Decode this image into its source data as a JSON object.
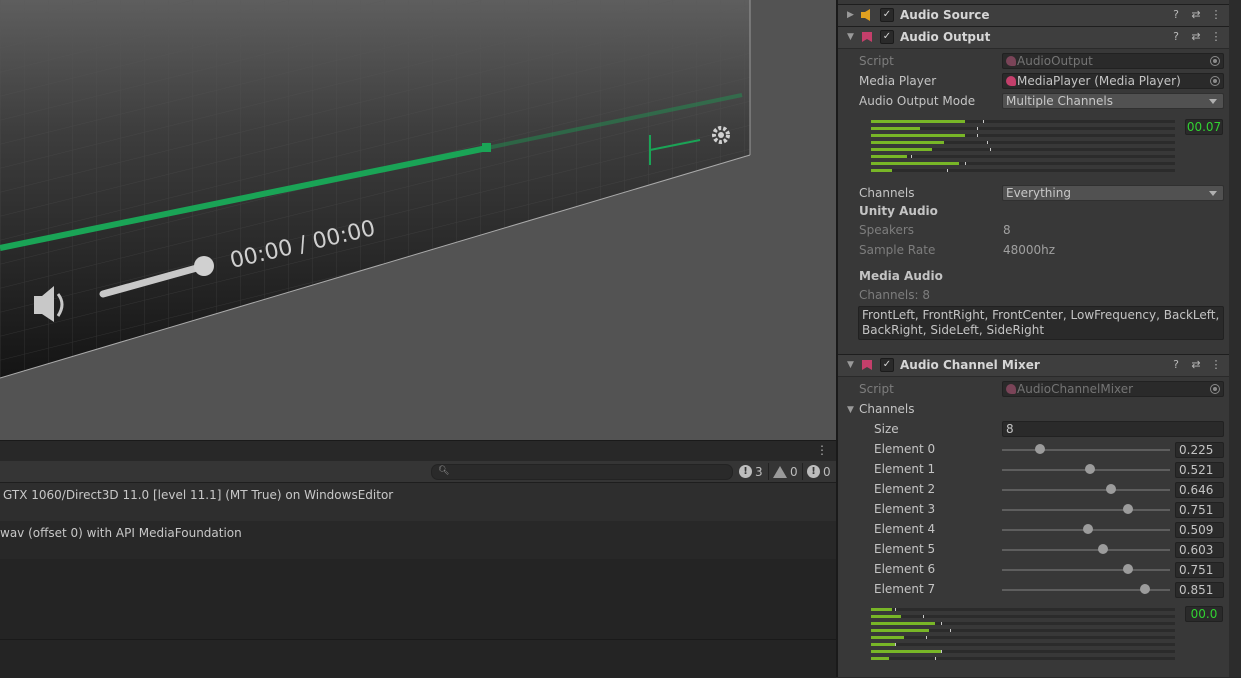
{
  "scene": {
    "time_display": "00:00 / 00:00",
    "accent_color": "#1aa456"
  },
  "console": {
    "counts": {
      "errors": "3",
      "warnings": "0",
      "infos": "0"
    },
    "search_placeholder": "",
    "logs": [
      "GTX 1060/Direct3D 11.0 [level 11.1] (MT True) on WindowsEditor",
      "wav (offset 0) with API MediaFoundation"
    ]
  },
  "inspector": {
    "audio_source": {
      "title": "Audio Source",
      "enabled": true
    },
    "audio_output": {
      "title": "Audio Output",
      "script_label": "Script",
      "script_value": "AudioOutput",
      "media_player_label": "Media Player",
      "media_player_value": "MediaPlayer (Media Player)",
      "output_mode_label": "Audio Output Mode",
      "output_mode_value": "Multiple Channels",
      "meter_value": "00.07",
      "meter_levels": [
        0.31,
        0.16,
        0.31,
        0.24,
        0.2,
        0.12,
        0.29,
        0.07
      ],
      "meter_peaks": [
        0.37,
        0.35,
        0.35,
        0.38,
        0.39,
        0.13,
        0.31,
        0.25
      ],
      "channels_label": "Channels",
      "channels_value": "Everything",
      "unity_audio_header": "Unity Audio",
      "speakers_label": "Speakers",
      "speakers_value": "8",
      "sample_rate_label": "Sample Rate",
      "sample_rate_value": "48000hz",
      "media_audio_header": "Media Audio",
      "media_channels_text": "Channels: 8",
      "channel_layout_text": "FrontLeft, FrontRight, FrontCenter, LowFrequency, BackLeft, BackRight, SideLeft, SideRight"
    },
    "audio_channel_mixer": {
      "title": "Audio Channel Mixer",
      "script_label": "Script",
      "script_value": "AudioChannelMixer",
      "channels_label": "Channels",
      "size_label": "Size",
      "size_value": "8",
      "elements": [
        {
          "label": "Element 0",
          "value": "0.225",
          "level": 0.225
        },
        {
          "label": "Element 1",
          "value": "0.521",
          "level": 0.521
        },
        {
          "label": "Element 2",
          "value": "0.646",
          "level": 0.646
        },
        {
          "label": "Element 3",
          "value": "0.751",
          "level": 0.751
        },
        {
          "label": "Element 4",
          "value": "0.509",
          "level": 0.509
        },
        {
          "label": "Element 5",
          "value": "0.603",
          "level": 0.603
        },
        {
          "label": "Element 6",
          "value": "0.751",
          "level": 0.751
        },
        {
          "label": "Element 7",
          "value": "0.851",
          "level": 0.851
        }
      ],
      "meter_value": "00.0",
      "meter_levels": [
        0.07,
        0.1,
        0.21,
        0.19,
        0.11,
        0.08,
        0.23,
        0.06
      ],
      "meter_peaks": [
        0.08,
        0.17,
        0.23,
        0.26,
        0.18,
        0.08,
        0.23,
        0.21
      ]
    }
  }
}
